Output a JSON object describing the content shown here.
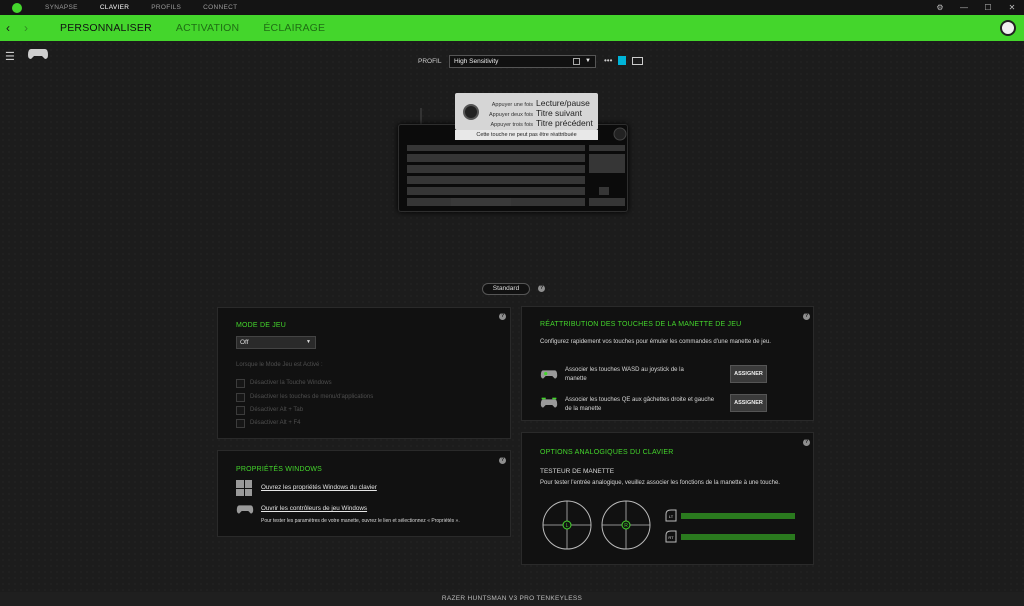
{
  "titlebar": {
    "tabs": [
      {
        "label": "SYNAPSE",
        "active": false
      },
      {
        "label": "CLAVIER",
        "active": true
      },
      {
        "label": "PROFILS",
        "active": false
      },
      {
        "label": "CONNECT",
        "active": false
      }
    ],
    "window_controls": [
      "⚙",
      "—",
      "☐",
      "✕"
    ]
  },
  "nav": {
    "back_icon": "chevron-left-icon",
    "forward_icon": "chevron-right-icon",
    "tabs": [
      {
        "label": "PERSONNALISER",
        "active": true
      },
      {
        "label": "ACTIVATION",
        "active": false
      },
      {
        "label": "ÉCLAIRAGE",
        "active": false
      }
    ]
  },
  "profile": {
    "label": "PROFIL",
    "selected": "High Sensitivity"
  },
  "tooltip": {
    "rows": [
      {
        "action": "Appuyer une fois",
        "result": "Lecture/pause"
      },
      {
        "action": "Appuyer deux fois",
        "result": "Titre suivant"
      },
      {
        "action": "Appuyer trois fois",
        "result": "Titre précédent"
      }
    ],
    "note": "Cette touche ne peut pas être réattribuée"
  },
  "mode_button": "Standard",
  "game_mode": {
    "title": "MODE DE JEU",
    "selected": "Off",
    "hint": "Lorsque le Mode Jeu est Activé :",
    "options": [
      "Désactiver la Touche Windows",
      "Désactiver les touches de menu/d'applications",
      "Désactiver Alt + Tab",
      "Désactiver Alt + F4"
    ]
  },
  "windows_props": {
    "title": "PROPRIÉTÉS WINDOWS",
    "link1": "Ouvrez les propriétés Windows du clavier",
    "link2": "Ouvrir les contrôleurs de jeu Windows",
    "desc": "Pour tester les paramètres de votre manette, ouvrez le lien et sélectionnez « Propriétés »."
  },
  "gamepad_remap": {
    "title": "RÉATTRIBUTION DES TOUCHES DE LA MANETTE DE JEU",
    "desc": "Configurez rapidement vos touches pour émuler les commandes d'une manette de jeu.",
    "items": [
      {
        "label": "Associer les touches WASD au joystick de la manette",
        "button": "ASSIGNER"
      },
      {
        "label": "Associer les touches QE aux gâchettes droite et gauche de la manette",
        "button": "ASSIGNER"
      }
    ]
  },
  "analog": {
    "title": "OPTIONS ANALOGIQUES DU CLAVIER",
    "subtitle": "TESTEUR DE MANETTE",
    "desc": "Pour tester l'entrée analogique, veuillez associer les fonctions de la manette à une touche.",
    "sticks": [
      "L",
      "R"
    ],
    "triggers": [
      "LT",
      "RT"
    ],
    "trigger_levels": [
      0,
      0
    ]
  },
  "footer": "RAZER HUNTSMAN V3 PRO TENKEYLESS",
  "colors": {
    "accent": "#44d62c",
    "blue": "#00b4d8"
  }
}
